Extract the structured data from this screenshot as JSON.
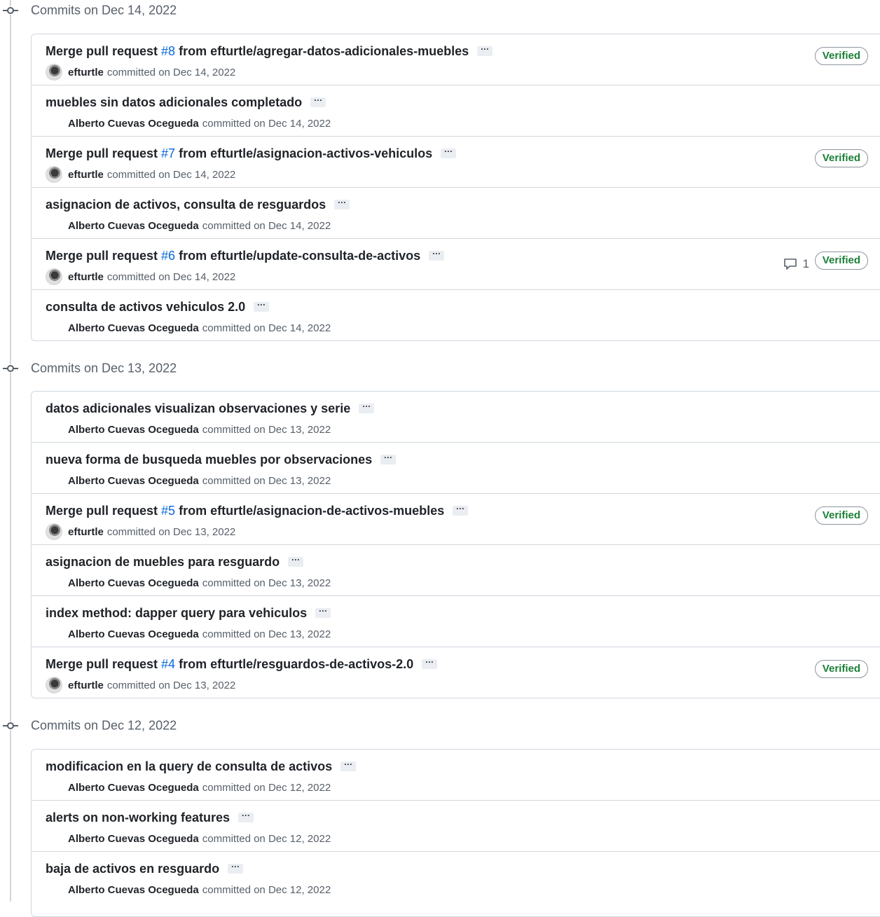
{
  "groups": [
    {
      "title": "Commits on Dec 14, 2022",
      "commits": [
        {
          "pre": "Merge pull request ",
          "pr": "#8",
          "post": " from efturtle/agregar-datos-adicionales-muebles",
          "author": "efturtle",
          "avatar": true,
          "action": "committed on Dec 14, 2022",
          "verified": "Verified",
          "comments": ""
        },
        {
          "pre": "muebles sin datos adicionales completado",
          "pr": "",
          "post": "",
          "author": "Alberto Cuevas Ocegueda",
          "avatar": false,
          "action": "committed on Dec 14, 2022",
          "verified": "",
          "comments": ""
        },
        {
          "pre": "Merge pull request ",
          "pr": "#7",
          "post": " from efturtle/asignacion-activos-vehiculos",
          "author": "efturtle",
          "avatar": true,
          "action": "committed on Dec 14, 2022",
          "verified": "Verified",
          "comments": ""
        },
        {
          "pre": "asignacion de activos, consulta de resguardos",
          "pr": "",
          "post": "",
          "author": "Alberto Cuevas Ocegueda",
          "avatar": false,
          "action": "committed on Dec 14, 2022",
          "verified": "",
          "comments": ""
        },
        {
          "pre": "Merge pull request ",
          "pr": "#6",
          "post": " from efturtle/update-consulta-de-activos",
          "author": "efturtle",
          "avatar": true,
          "action": "committed on Dec 14, 2022",
          "verified": "Verified",
          "comments": "1"
        },
        {
          "pre": "consulta de activos vehiculos 2.0",
          "pr": "",
          "post": "",
          "author": "Alberto Cuevas Ocegueda",
          "avatar": false,
          "action": "committed on Dec 14, 2022",
          "verified": "",
          "comments": ""
        }
      ]
    },
    {
      "title": "Commits on Dec 13, 2022",
      "commits": [
        {
          "pre": "datos adicionales visualizan observaciones y serie",
          "pr": "",
          "post": "",
          "author": "Alberto Cuevas Ocegueda",
          "avatar": false,
          "action": "committed on Dec 13, 2022",
          "verified": "",
          "comments": ""
        },
        {
          "pre": "nueva forma de busqueda muebles por observaciones",
          "pr": "",
          "post": "",
          "author": "Alberto Cuevas Ocegueda",
          "avatar": false,
          "action": "committed on Dec 13, 2022",
          "verified": "",
          "comments": ""
        },
        {
          "pre": "Merge pull request ",
          "pr": "#5",
          "post": " from efturtle/asignacion-de-activos-muebles",
          "author": "efturtle",
          "avatar": true,
          "action": "committed on Dec 13, 2022",
          "verified": "Verified",
          "comments": ""
        },
        {
          "pre": "asignacion de muebles para resguardo",
          "pr": "",
          "post": "",
          "author": "Alberto Cuevas Ocegueda",
          "avatar": false,
          "action": "committed on Dec 13, 2022",
          "verified": "",
          "comments": ""
        },
        {
          "pre": "index method: dapper query para vehiculos",
          "pr": "",
          "post": "",
          "author": "Alberto Cuevas Ocegueda",
          "avatar": false,
          "action": "committed on Dec 13, 2022",
          "verified": "",
          "comments": ""
        },
        {
          "pre": "Merge pull request ",
          "pr": "#4",
          "post": " from efturtle/resguardos-de-activos-2.0",
          "author": "efturtle",
          "avatar": true,
          "action": "committed on Dec 13, 2022",
          "verified": "Verified",
          "comments": ""
        }
      ]
    },
    {
      "title": "Commits on Dec 12, 2022",
      "commits": [
        {
          "pre": "modificacion en la query de consulta de activos",
          "pr": "",
          "post": "",
          "author": "Alberto Cuevas Ocegueda",
          "avatar": false,
          "action": "committed on Dec 12, 2022",
          "verified": "",
          "comments": ""
        },
        {
          "pre": "alerts on non-working features",
          "pr": "",
          "post": "",
          "author": "Alberto Cuevas Ocegueda",
          "avatar": false,
          "action": "committed on Dec 12, 2022",
          "verified": "",
          "comments": ""
        },
        {
          "pre": "baja de activos en resguardo",
          "pr": "",
          "post": "",
          "author": "Alberto Cuevas Ocegueda",
          "avatar": false,
          "action": "committed on Dec 12, 2022",
          "verified": "",
          "comments": ""
        }
      ]
    }
  ],
  "ellipsis": "···"
}
